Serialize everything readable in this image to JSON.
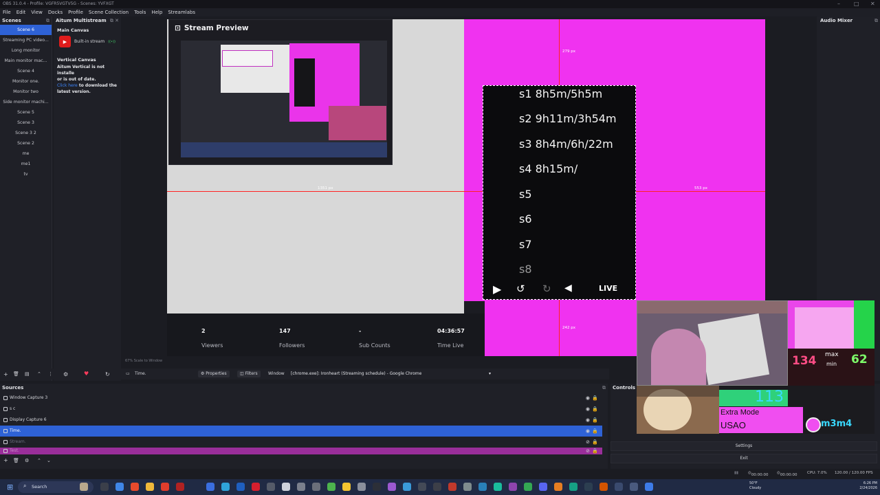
{
  "window": {
    "title": "OBS 31.0.4 - Profile: VGFR5VGTV5G - Scenes: YVFXGT",
    "controls": [
      "–",
      "□",
      "✕"
    ]
  },
  "menu": [
    "File",
    "Edit",
    "View",
    "Docks",
    "Profile",
    "Scene Collection",
    "Tools",
    "Help",
    "Streamlabs"
  ],
  "scenes": {
    "title": "Scenes",
    "items": [
      "Scene 6",
      "Streaming PC video...",
      "Long monitor",
      "Main monitor mac...",
      "Scene 4",
      "Monitor one.",
      "Monitor two",
      "Side monitor machi...",
      "Scene 5",
      "Scene 3",
      "Scene 3 2",
      "Scene 2",
      "me",
      "me1",
      "tv"
    ],
    "selected_index": 0
  },
  "multistream": {
    "title": "Aitum Multistream",
    "main_canvas": "Main Canvas",
    "output_label": "Built-in stream",
    "vertical_canvas": "Vertical Canvas",
    "warning_line1": "Aitum Vertical is not installe",
    "warning_line2": "or is out of date.",
    "warning_link": "Click here",
    "warning_line3": " to download the",
    "warning_line4": "latest version."
  },
  "preview": {
    "stream_preview_title": "Stream Preview",
    "guide_top": "279 px",
    "guide_left": "1351 px",
    "guide_right": "553 px",
    "guide_bottom": "242 px",
    "schedule": [
      "s1 8h5m/5h5m",
      "s2 9h11m/3h54m",
      "s3 8h4m/6h/22m",
      "s4 8h15m/",
      "s5",
      "s6",
      "s7",
      "s8"
    ],
    "live_label": "LIVE",
    "stats": [
      {
        "value": "2",
        "label": "Viewers"
      },
      {
        "value": "147",
        "label": "Followers"
      },
      {
        "value": "-",
        "label": "Sub Counts"
      },
      {
        "value": "04:36:57",
        "label": "Time Live"
      }
    ],
    "zoom_text": "67%   Scale to Window"
  },
  "audio_mixer": {
    "title": "Audio Mixer"
  },
  "source_toolbar": {
    "selected_source": "Time.",
    "properties": "Properties",
    "filters": "Filters",
    "window_label": "Window",
    "window_value": "[chrome.exe]: Ironheart (Streaming schedule) - Google Chrome"
  },
  "sources": {
    "title": "Sources",
    "items": [
      "Window Capture 3",
      "s c",
      "Display Capture 6",
      "Time.",
      "Stream.",
      "Test."
    ]
  },
  "controls": {
    "title": "Controls",
    "settings": "Settings",
    "exit": "Exit"
  },
  "overlay": {
    "max_label": "max",
    "min_label": "min",
    "left_count": "134",
    "right_count": "62",
    "song_count": "113",
    "mode": "Extra Mode",
    "artist": "USAO",
    "player_tag": "m3m4"
  },
  "status": {
    "time1": "00:00:00",
    "time2": "00:00:00",
    "cpu": "CPU: 7.0%",
    "fps": "120.00 / 120.00 FPS"
  },
  "taskbar": {
    "search": "Search",
    "weather_temp": "50°F",
    "weather_desc": "Cloudy",
    "time": "6:26 PM",
    "date": "2/24/2026"
  },
  "colors": {
    "accent": "#2e62d6",
    "canvas_pink": "#f032f0",
    "guide_red": "#ff2222"
  }
}
